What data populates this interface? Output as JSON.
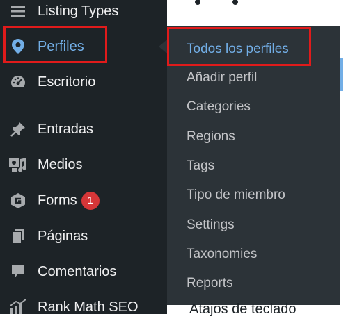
{
  "sidebar": {
    "items": [
      {
        "label": "Listing Types",
        "icon": "list-icon"
      },
      {
        "label": "Perfiles",
        "icon": "location-pin-icon"
      },
      {
        "label": "Escritorio",
        "icon": "dashboard-icon"
      },
      {
        "label": "Entradas",
        "icon": "pin-icon"
      },
      {
        "label": "Medios",
        "icon": "media-icon"
      },
      {
        "label": "Forms",
        "icon": "forms-icon",
        "badge": "1"
      },
      {
        "label": "Páginas",
        "icon": "pages-icon"
      },
      {
        "label": "Comentarios",
        "icon": "comments-icon"
      },
      {
        "label": "Rank Math SEO",
        "icon": "rank-math-icon"
      }
    ]
  },
  "submenu": {
    "items": [
      "Todos los perfiles",
      "Añadir perfil",
      "Categories",
      "Regions",
      "Tags",
      "Tipo de miembro",
      "Settings",
      "Taxonomies",
      "Reports"
    ]
  },
  "background": {
    "bottom_text": "Atajos de teclado"
  },
  "colors": {
    "sidebar_bg": "#1d2327",
    "submenu_bg": "#2c3338",
    "accent": "#72aee6",
    "highlight": "#e01b1b",
    "badge": "#d63638"
  }
}
